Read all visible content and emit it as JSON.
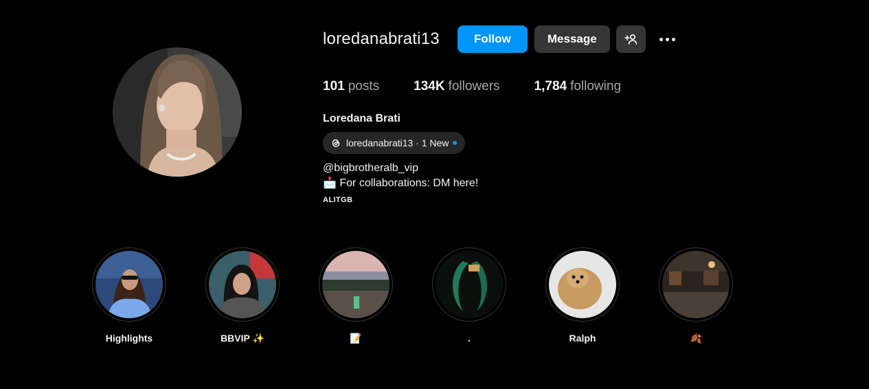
{
  "profile": {
    "username": "loredanabrati13",
    "full_name": "Loredana Brati",
    "avatar_icon": "profile-photo"
  },
  "actions": {
    "follow_label": "Follow",
    "message_label": "Message",
    "suggest_icon": "add-person-icon",
    "more_icon": "more-options-icon",
    "follow_color": "#0095f6",
    "secondary_color": "#363636"
  },
  "stats": {
    "posts_count": "101",
    "posts_label": "posts",
    "followers_count": "134K",
    "followers_label": "followers",
    "following_count": "1,784",
    "following_label": "following"
  },
  "threads": {
    "handle": "loredanabrati13 · 1 New",
    "icon": "threads-icon",
    "dot_color": "#0095f6"
  },
  "bio": {
    "line1": "@bigbrotheralb_vip",
    "line2": "📩 For collaborations: DM here!",
    "tag": "ALITGB"
  },
  "highlights": [
    {
      "label": "Highlights"
    },
    {
      "label": "BBVIP ✨"
    },
    {
      "label": "📝"
    },
    {
      "label": "."
    },
    {
      "label": "Ralph"
    },
    {
      "label": "🍂"
    }
  ]
}
